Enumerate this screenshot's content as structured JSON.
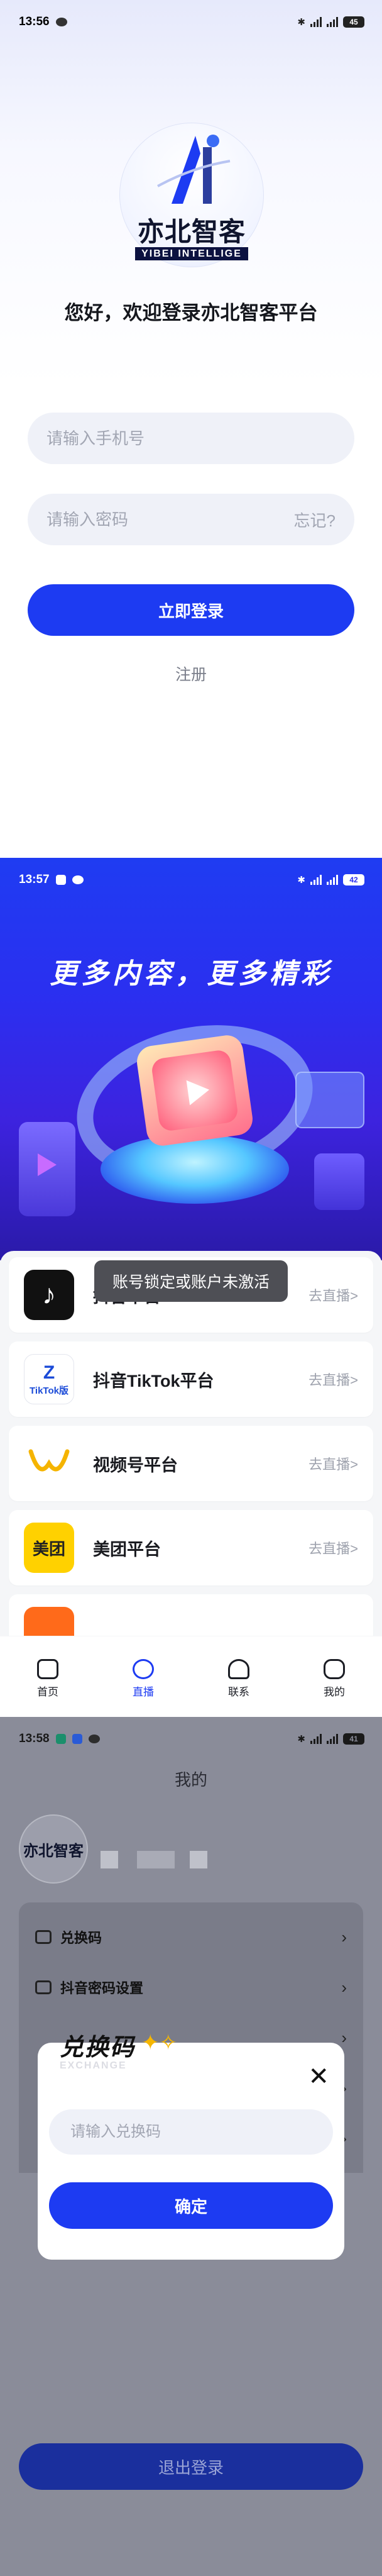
{
  "screens": [
    {
      "status": {
        "time": "13:56",
        "battery": "45"
      },
      "logo": {
        "main": "亦北智客",
        "sub": "YIBEI INTELLIGE"
      },
      "welcome": "您好，欢迎登录亦北智客平台",
      "phone_placeholder": "请输入手机号",
      "password_placeholder": "请输入密码",
      "forgot": "忘记?",
      "login_button": "立即登录",
      "register": "注册"
    },
    {
      "status": {
        "time": "13:57",
        "battery": "42"
      },
      "banner_title": "更多内容，更多精彩",
      "toast": "账号锁定或账户未激活",
      "platforms": [
        {
          "name": "抖音平台",
          "go": "去直播>",
          "icon": "douyin-icon"
        },
        {
          "name": "抖音TikTok平台",
          "go": "去直播>",
          "icon": "tiktok-icon"
        },
        {
          "name": "视频号平台",
          "go": "去直播>",
          "icon": "shipinhao-icon"
        },
        {
          "name": "美团平台",
          "go": "去直播>",
          "icon": "meituan-icon"
        }
      ],
      "tiktok_icon_text": "TikTok版",
      "meituan_icon_text": "美团",
      "tabs": [
        {
          "label": "首页",
          "icon": "home-icon",
          "active": false
        },
        {
          "label": "直播",
          "icon": "live-icon",
          "active": true
        },
        {
          "label": "联系",
          "icon": "headset-icon",
          "active": false
        },
        {
          "label": "我的",
          "icon": "profile-icon",
          "active": false
        }
      ],
      "colors": {
        "accent": "#1d3bf2"
      }
    },
    {
      "status": {
        "time": "13:58",
        "battery": "41"
      },
      "title": "我的",
      "avatar_text": "亦北智客",
      "menu": [
        {
          "label": "兑换码"
        },
        {
          "label": "抖音密码设置"
        },
        {
          "label": ""
        },
        {
          "label": ""
        },
        {
          "label": ""
        }
      ],
      "modal": {
        "title": "兑换码",
        "subtitle": "EXCHANGE",
        "placeholder": "请输入兑换码",
        "confirm": "确定"
      },
      "logout": "退出登录"
    }
  ]
}
